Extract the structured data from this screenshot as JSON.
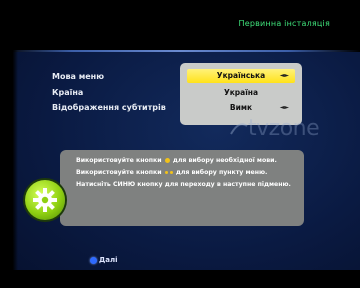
{
  "header": {
    "title": "Первинна інсталяція"
  },
  "menu": {
    "items": [
      {
        "label": "Мова меню",
        "value": "Українська",
        "selected": true,
        "arrows": "◄►"
      },
      {
        "label": "Країна",
        "value": "Україна",
        "selected": false,
        "arrows": ""
      },
      {
        "label": "Відображення субтитрів",
        "value": "Вимк",
        "selected": false,
        "arrows": "◄►"
      }
    ]
  },
  "help": {
    "line1_before": "Використовуйте кнопки",
    "line1_after": "для вибору необхідної мови.",
    "line2_before": "Використовуйте кнопки",
    "line2_after": "для вибору пункту меню.",
    "line3": "Натисніть СИНЮ кнопку для переходу в наступне підменю."
  },
  "footer": {
    "next_label": "Далі"
  },
  "watermark": "tvzone",
  "colors": {
    "header_text": "#3fe07a",
    "selected_bg": "#ffe21a",
    "panel_bg": "#c9cbc9",
    "help_bg": "#7f8180",
    "blue_button": "#2f6bff",
    "gear_green": "#8fd012"
  },
  "icons": {
    "gear": "gear-icon",
    "left_right_arrows": "left-right-arrows-icon",
    "up_down_arrows": "up-down-arrows-icon",
    "blue_button": "blue-button-icon"
  }
}
